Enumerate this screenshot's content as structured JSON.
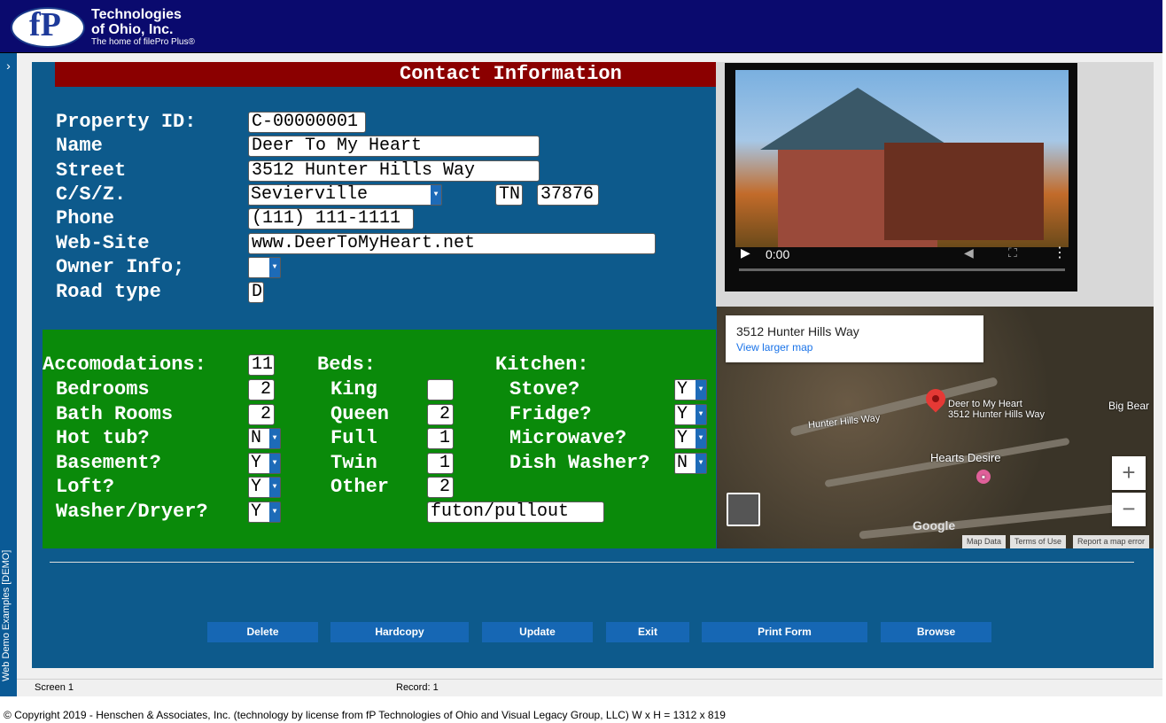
{
  "brand": {
    "logo_text": "fP",
    "line1": "Technologies",
    "line2": "of Ohio, Inc.",
    "tagline": "The home of filePro Plus®"
  },
  "sidebar": {
    "chevron": "›",
    "label": "Web Demo Examples [DEMO]"
  },
  "form": {
    "title": "Contact Information",
    "labels": {
      "property_id": "Property ID:",
      "name": "Name",
      "street": "Street",
      "csz": "C/S/Z.",
      "phone": "Phone",
      "website": "Web-Site",
      "owner": "Owner Info;",
      "road": "Road type"
    },
    "values": {
      "property_id": "C-00000001",
      "name": "Deer To My Heart",
      "street": "3512 Hunter Hills Way",
      "city": "Sevierville",
      "state": "TN",
      "zip": "37876",
      "phone": "(111) 111-1111",
      "website": "www.DeerToMyHeart.net",
      "owner": "",
      "road": "D"
    }
  },
  "amenities": {
    "headers": {
      "accom": "Accomodations:",
      "beds": "Beds:",
      "kitchen": "Kitchen:"
    },
    "accom_value": "11",
    "accom": [
      {
        "label": "Bedrooms",
        "value": "2"
      },
      {
        "label": "Bath Rooms",
        "value": "2"
      },
      {
        "label": "Hot tub?",
        "value": "N"
      },
      {
        "label": "Basement?",
        "value": "Y"
      },
      {
        "label": "Loft?",
        "value": "Y"
      },
      {
        "label": "Washer/Dryer?",
        "value": "Y"
      }
    ],
    "beds": [
      {
        "label": "King",
        "value": ""
      },
      {
        "label": "Queen",
        "value": "2"
      },
      {
        "label": "Full",
        "value": "1"
      },
      {
        "label": "Twin",
        "value": "1"
      },
      {
        "label": "Other",
        "value": "2"
      }
    ],
    "other_desc": "futon/pullout",
    "kitchen": [
      {
        "label": "Stove?",
        "value": "Y"
      },
      {
        "label": "Fridge?",
        "value": "Y"
      },
      {
        "label": "Microwave?",
        "value": "Y"
      },
      {
        "label": "Dish Washer?",
        "value": "N"
      }
    ]
  },
  "video": {
    "time": "0:00"
  },
  "map": {
    "card_address": "3512 Hunter Hills Way",
    "card_link": "View larger map",
    "pin_title": "Deer to My Heart",
    "pin_address": "3512 Hunter Hills Way",
    "road_label": "Hunter Hills Way",
    "place_label": "Hearts Desire",
    "edge_label": "Big Bear",
    "google": "Google",
    "footer": [
      "Map Data",
      "Terms of Use",
      "Report a map error"
    ],
    "zoom_in": "+",
    "zoom_out": "−"
  },
  "buttons": {
    "delete": "Delete",
    "hardcopy": "Hardcopy",
    "update": "Update",
    "exit": "Exit",
    "print": "Print Form",
    "browse": "Browse"
  },
  "status": {
    "screen": "Screen 1",
    "record": "Record: 1"
  },
  "footer": "© Copyright 2019 - Henschen & Associates, Inc. (technology by license from fP Technologies of Ohio and Visual Legacy Group, LLC)   W x H = 1312 x 819",
  "colors": {
    "header": "#0a0a6e",
    "form": "#0d5a8c",
    "title": "#8b0000",
    "amenities": "#0a8a0a",
    "button": "#1667b4"
  }
}
